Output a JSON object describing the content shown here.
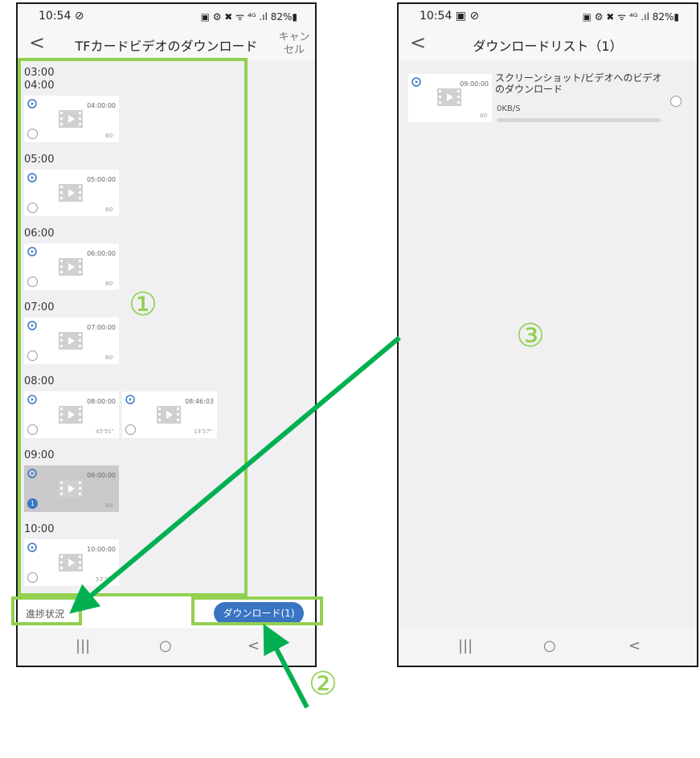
{
  "left_screen": {
    "status_time": "10:54 ⊘",
    "status_icons": "▣ ⚙ ✖ ᯤ ⁴ᴳ .ıl 82%▮",
    "header": {
      "back_label": "<",
      "title": "TFカードビデオのダウンロード",
      "cancel_label": "キャンセル"
    },
    "timeline": {
      "first_hour": "03:00",
      "groups": [
        {
          "hour": "04:00",
          "clips": [
            {
              "stamp": "04:00:00",
              "duration": "60'",
              "selected": false
            }
          ]
        },
        {
          "hour": "05:00",
          "clips": [
            {
              "stamp": "05:00:00",
              "duration": "60'",
              "selected": false
            }
          ]
        },
        {
          "hour": "06:00",
          "clips": [
            {
              "stamp": "06:00:00",
              "duration": "60'",
              "selected": false
            }
          ]
        },
        {
          "hour": "07:00",
          "clips": [
            {
              "stamp": "07:00:00",
              "duration": "60'",
              "selected": false
            }
          ]
        },
        {
          "hour": "08:00",
          "clips": [
            {
              "stamp": "08:00:00",
              "duration": "45'51\"",
              "selected": false
            },
            {
              "stamp": "08:46:03",
              "duration": "13'57\"",
              "selected": false
            }
          ]
        },
        {
          "hour": "09:00",
          "clips": [
            {
              "stamp": "09:00:00",
              "duration": "60'",
              "selected": true,
              "order": "1"
            }
          ]
        },
        {
          "hour": "10:00",
          "clips": [
            {
              "stamp": "10:00:00",
              "duration": "53'19\"",
              "selected": false
            }
          ]
        }
      ]
    },
    "bottom": {
      "progress_label": "進捗状況",
      "download_button": "ダウンロード(1)"
    },
    "nav": {
      "recent": "|||",
      "home": "○",
      "back": "<"
    }
  },
  "right_screen": {
    "status_time": "10:54 ▣ ⊘",
    "status_icons": "▣ ⚙ ✖ ᯤ ⁴ᴳ .ıl 82%▮",
    "header": {
      "back_label": "<",
      "title": "ダウンロードリスト（1）"
    },
    "item": {
      "stamp": "09:00:00",
      "duration": "60'",
      "name": "スクリーンショット/ビデオへのビデオのダウンロード",
      "speed": "0KB/S",
      "progress": 0
    },
    "nav": {
      "recent": "|||",
      "home": "○",
      "back": "<"
    }
  },
  "annotations": {
    "one": "①",
    "two": "②",
    "three": "③",
    "accent_color": "#92d050",
    "arrow_color": "#00b050"
  }
}
